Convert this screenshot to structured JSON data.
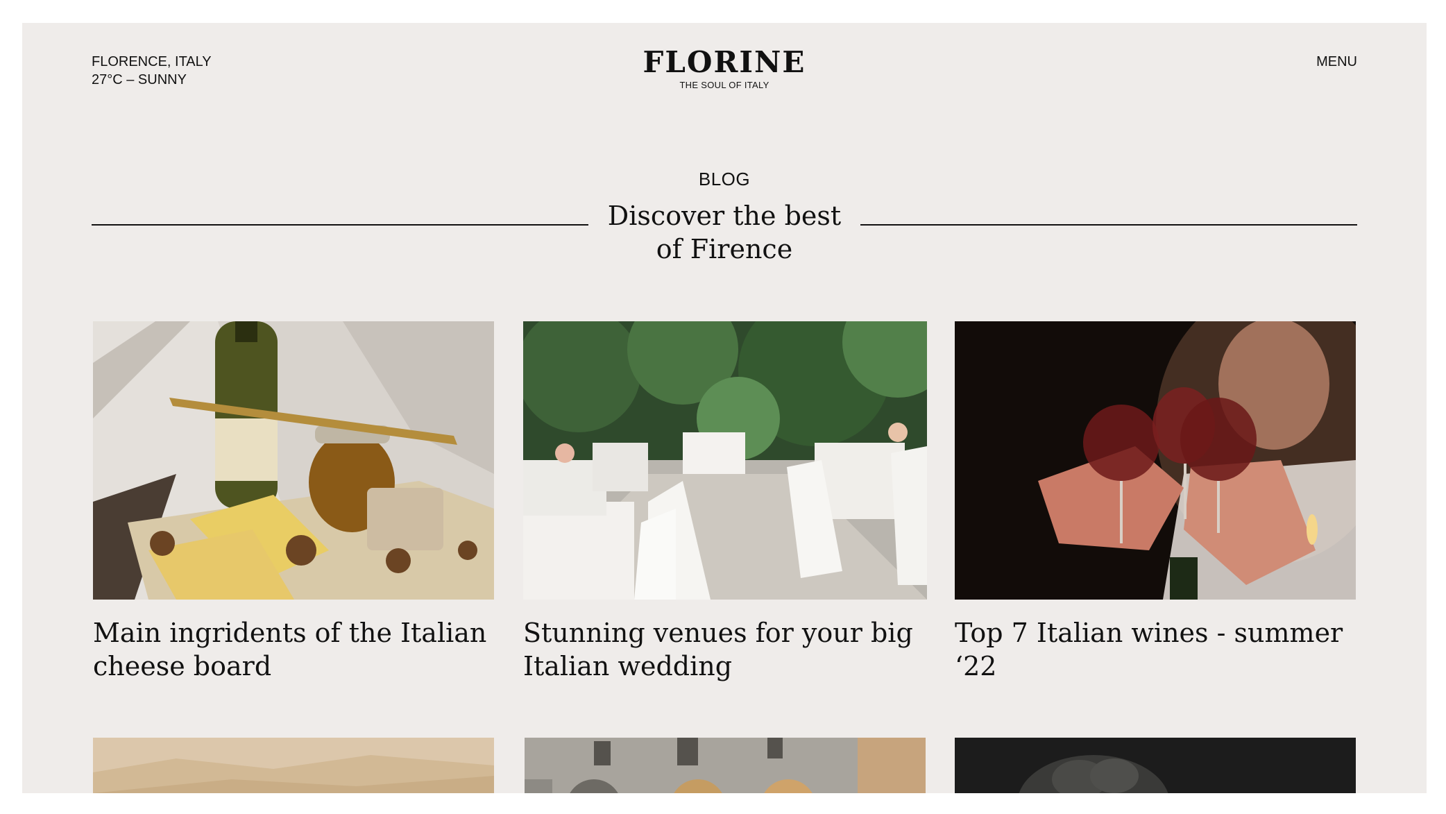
{
  "header": {
    "location": "FLORENCE, ITALY",
    "weather": "27°C – SUNNY",
    "brand": "FLORINE",
    "tagline": "THE SOUL OF ITALY",
    "menu_label": "MENU"
  },
  "section": {
    "label": "BLOG",
    "headline_line1": "Discover the best",
    "headline_line2": "of Firence"
  },
  "posts": [
    {
      "title": "Main ingridents of the Italian cheese board",
      "image": "cheese-board-photo"
    },
    {
      "title": "Stunning venues for your big Italian wedding",
      "image": "wedding-venue-photo"
    },
    {
      "title": "Top 7 Italian wines - summer ‘22",
      "image": "wine-toast-photo"
    }
  ],
  "more_posts": [
    {
      "image": "tuscan-hills-photo"
    },
    {
      "image": "florence-building-photo"
    },
    {
      "image": "statue-photo"
    }
  ],
  "colors": {
    "page_bg": "#efecea",
    "text": "#111111",
    "outer_bg": "#ffffff"
  }
}
